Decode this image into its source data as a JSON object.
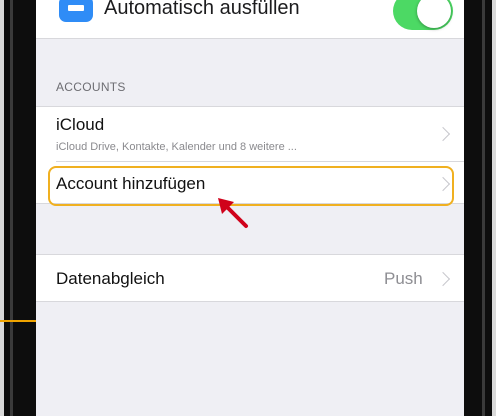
{
  "top_row": {
    "label": "Automatisch ausfüllen",
    "toggle_on": true
  },
  "accounts_section": {
    "header": "ACCOUNTS",
    "items": [
      {
        "title": "iCloud",
        "subtitle": "iCloud Drive, Kontakte, Kalender und 8 weitere ..."
      },
      {
        "title": "Account hinzufügen"
      }
    ]
  },
  "sync_section": {
    "title": "Datenabgleich",
    "value": "Push"
  },
  "colors": {
    "highlight": "#f0b020",
    "arrow": "#d0021b",
    "toggle": "#4cd964",
    "app_icon": "#2f8cf6"
  },
  "icons": [
    "app-icon",
    "chevron-right-icon",
    "annotation-arrow-icon"
  ]
}
